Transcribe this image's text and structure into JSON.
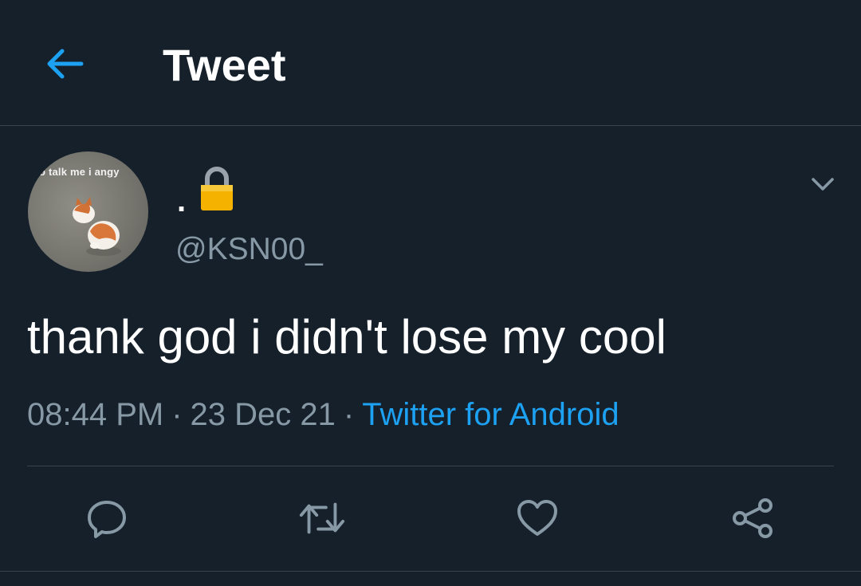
{
  "header": {
    "title": "Tweet",
    "back_icon": "arrow-left-icon"
  },
  "tweet": {
    "avatar_caption": "o talk me i angy",
    "display_name": ".",
    "protected_icon": "lock-icon",
    "handle": "@KSN00_",
    "text": "thank god i didn't lose my cool",
    "time": "08:44 PM",
    "date": "23 Dec 21",
    "separator": "·",
    "source": "Twitter for Android",
    "menu_icon": "chevron-down-icon"
  },
  "actions": [
    {
      "icon": "reply-icon"
    },
    {
      "icon": "retweet-icon"
    },
    {
      "icon": "like-icon"
    },
    {
      "icon": "share-icon"
    }
  ],
  "colors": {
    "background": "#15202b",
    "accent": "#1da1f2",
    "secondary_text": "#8899a6",
    "border": "#38444d"
  }
}
